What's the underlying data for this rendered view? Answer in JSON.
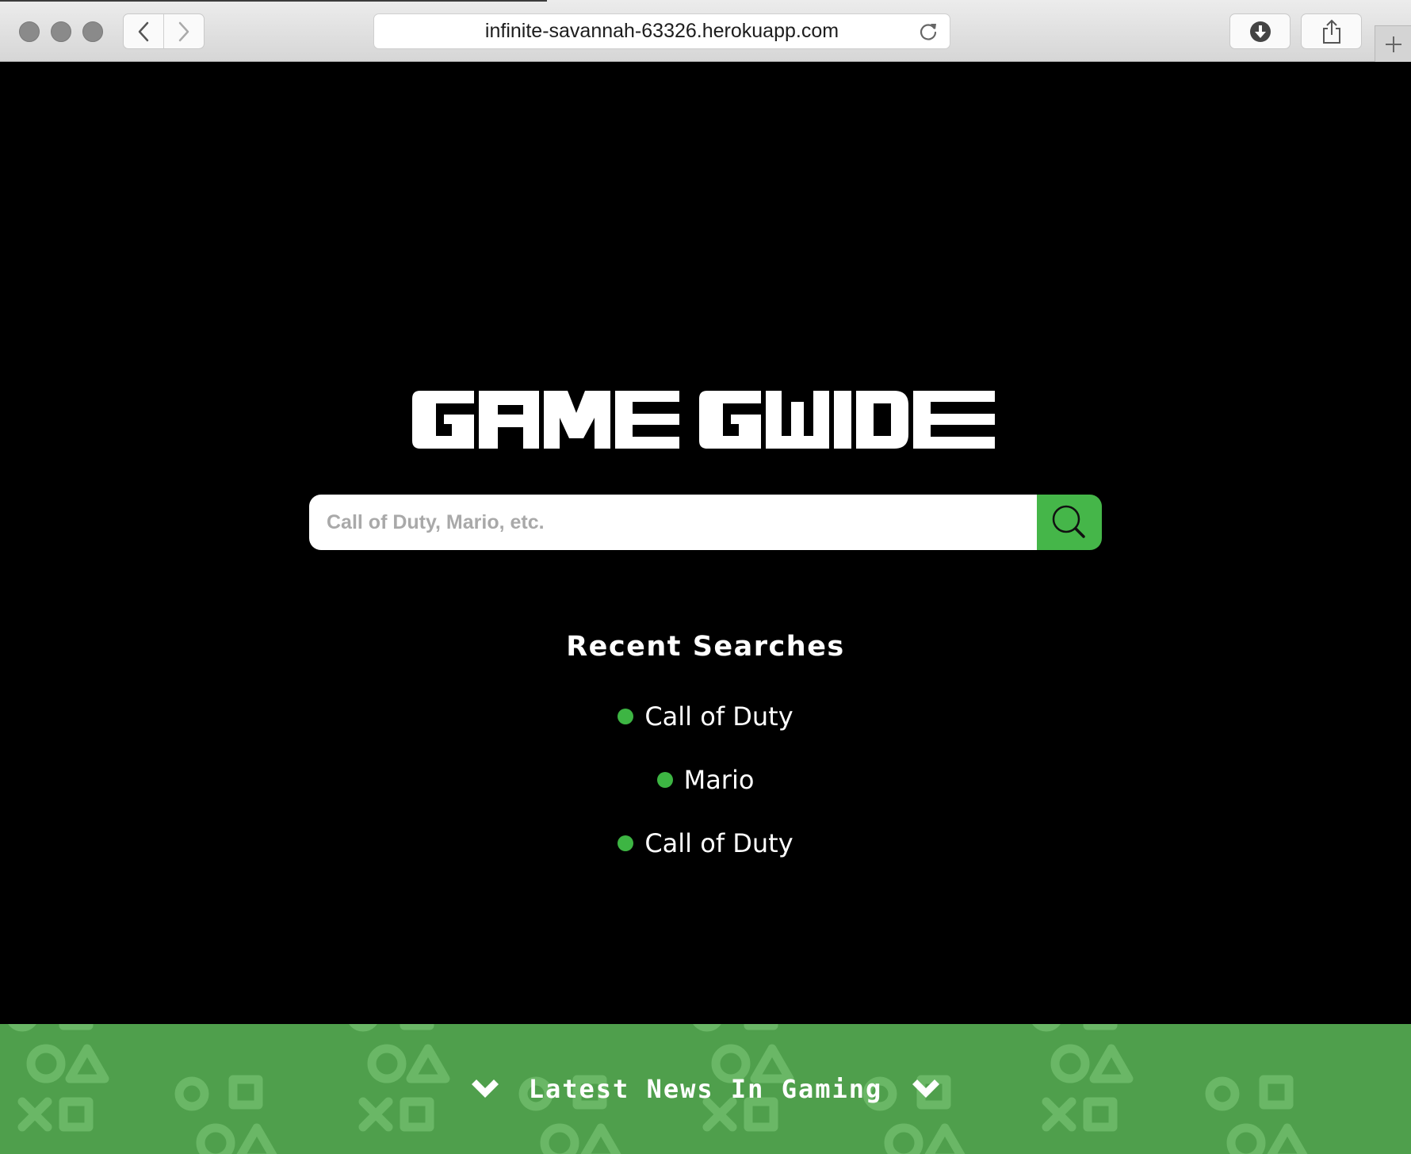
{
  "browser": {
    "url": "infinite-savannah-63326.herokuapp.com"
  },
  "page": {
    "logo_text": "GAME GUIDE",
    "search": {
      "placeholder": "Call of Duty, Mario, etc.",
      "value": ""
    },
    "recent_searches": {
      "title": "Recent Searches",
      "items": [
        {
          "label": "Call of Duty"
        },
        {
          "label": "Mario"
        },
        {
          "label": "Call of Duty"
        }
      ]
    },
    "news": {
      "label": "Latest News In Gaming"
    }
  },
  "colors": {
    "background": "#000000",
    "accent_green": "#45b649",
    "news_band": "#4f9f4c",
    "text": "#ffffff"
  },
  "icons": {
    "back": "chevron-left-icon",
    "forward": "chevron-right-icon",
    "reload": "reload-icon",
    "download": "download-icon",
    "share": "share-icon",
    "new_tab": "plus-icon",
    "search": "magnifier-icon",
    "news_toggle": "chevron-down-icon"
  }
}
